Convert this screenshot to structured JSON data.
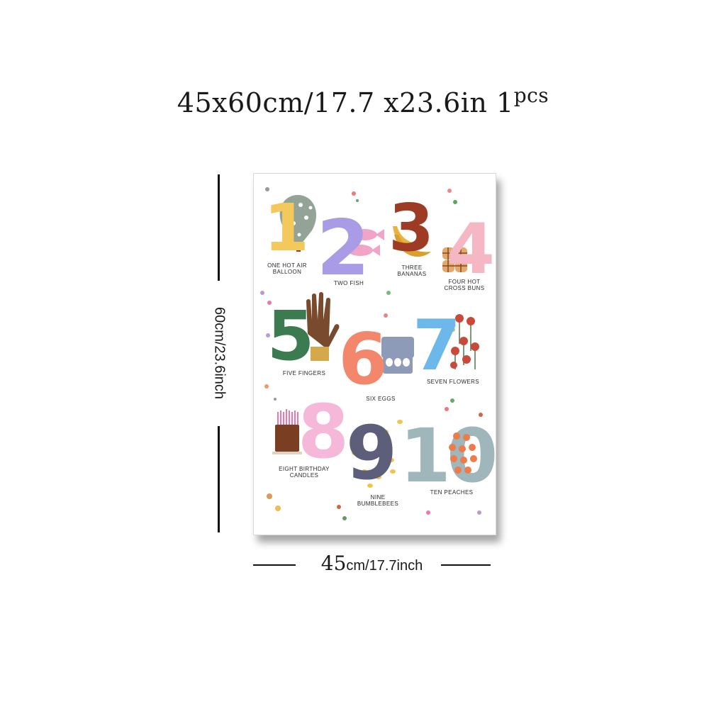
{
  "headline": {
    "size_text": "45x60cm/17.7 x23.6in",
    "count_text": "1",
    "count_unit": "pcs"
  },
  "dimensions": {
    "height_label": "60cm/23.6inch",
    "width_number": "45",
    "width_unit_text": "cm/17.7inch"
  },
  "poster": {
    "numbers": [
      {
        "numeral": "1",
        "caption_line1": "ONE HOT AIR",
        "caption_line2": "BALLOON",
        "color": "#f2c95a"
      },
      {
        "numeral": "2",
        "caption_line1": "TWO FISH",
        "caption_line2": "",
        "color": "#a99be6"
      },
      {
        "numeral": "3",
        "caption_line1": "THREE",
        "caption_line2": "BANANAS",
        "color": "#9e3b25"
      },
      {
        "numeral": "4",
        "caption_line1": "FOUR HOT",
        "caption_line2": "CROSS BUNS",
        "color": "#f6b7c5"
      },
      {
        "numeral": "5",
        "caption_line1": "FIVE FINGERS",
        "caption_line2": "",
        "color": "#3c7a4f"
      },
      {
        "numeral": "6",
        "caption_line1": "SIX EGGS",
        "caption_line2": "",
        "color": "#f2876c"
      },
      {
        "numeral": "7",
        "caption_line1": "SEVEN FLOWERS",
        "caption_line2": "",
        "color": "#6cb8ea"
      },
      {
        "numeral": "8",
        "caption_line1": "EIGHT BIRTHDAY",
        "caption_line2": "CANDLES",
        "color": "#f6b8d8"
      },
      {
        "numeral": "9",
        "caption_line1": "NINE",
        "caption_line2": "BUMBLEBEES",
        "color": "#5d5f7a"
      },
      {
        "numeral": "10",
        "caption_line1": "TEN PEACHES",
        "caption_line2": "",
        "color": "#9fb6bb"
      }
    ]
  },
  "colors": {
    "balloon": "#93a396",
    "fish": "#f1a4c8",
    "banana": "#e9b340",
    "bun": "#e6a868",
    "hand": "#7a4a2e",
    "cuff": "#d6a84c",
    "egg_carton": "#8d9bb8",
    "flower": "#c94a3b",
    "cake": "#7a3e22",
    "bee": "#f0c54a",
    "peach": "#ef7a4a",
    "ten_inner": "#ffffff"
  }
}
